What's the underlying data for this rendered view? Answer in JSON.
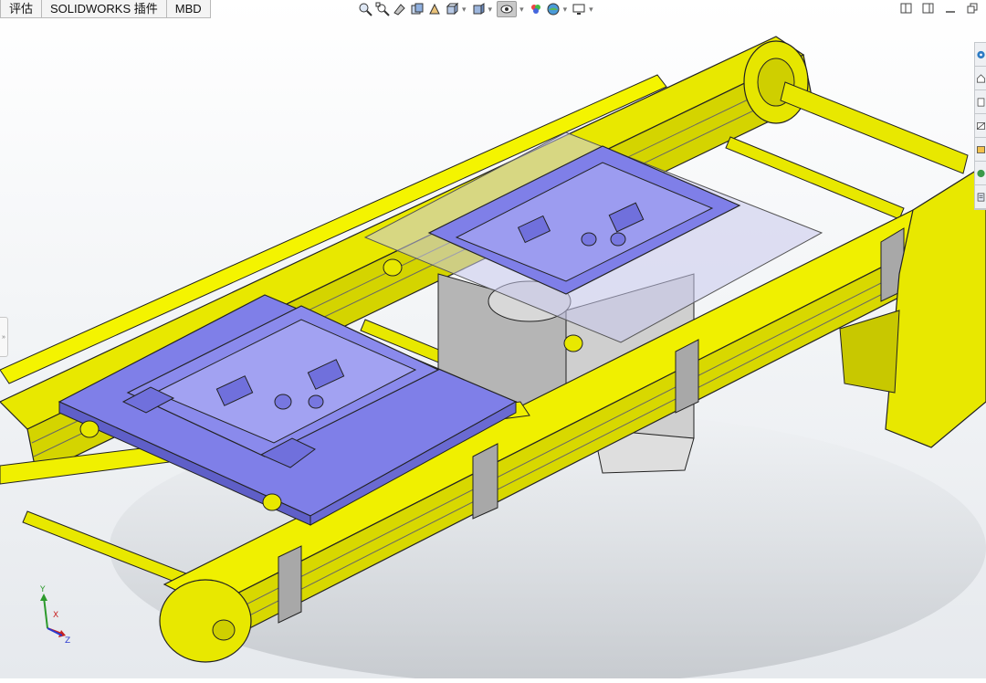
{
  "tabs": [
    {
      "label": "评估"
    },
    {
      "label": "SOLIDWORKS 插件"
    },
    {
      "label": "MBD"
    }
  ],
  "heads_up_toolbar": {
    "icons": [
      "zoom-to-fit-icon",
      "zoom-to-area-icon",
      "previous-view-icon",
      "section-view-icon",
      "dynamic-annotation-icon",
      "view-orientation-icon",
      "display-style-icon",
      "hide-show-items-icon",
      "edit-appearance-icon",
      "apply-scene-icon",
      "view-settings-icon"
    ]
  },
  "window_controls": [
    "tile-left-icon",
    "tile-right-icon",
    "minimize-icon",
    "restore-icon"
  ],
  "task_pane": [
    "solidworks-resources-icon",
    "design-library-icon",
    "file-explorer-icon",
    "view-palette-icon",
    "appearances-icon",
    "custom-properties-icon",
    "document-icon"
  ],
  "triad": {
    "x_label": "X",
    "y_label": "Y",
    "z_label": "Z"
  },
  "colors": {
    "frame_yellow": "#f0f000",
    "fixture_blue": "#7f7fe8",
    "steel_gray": "#a8a8a8"
  }
}
